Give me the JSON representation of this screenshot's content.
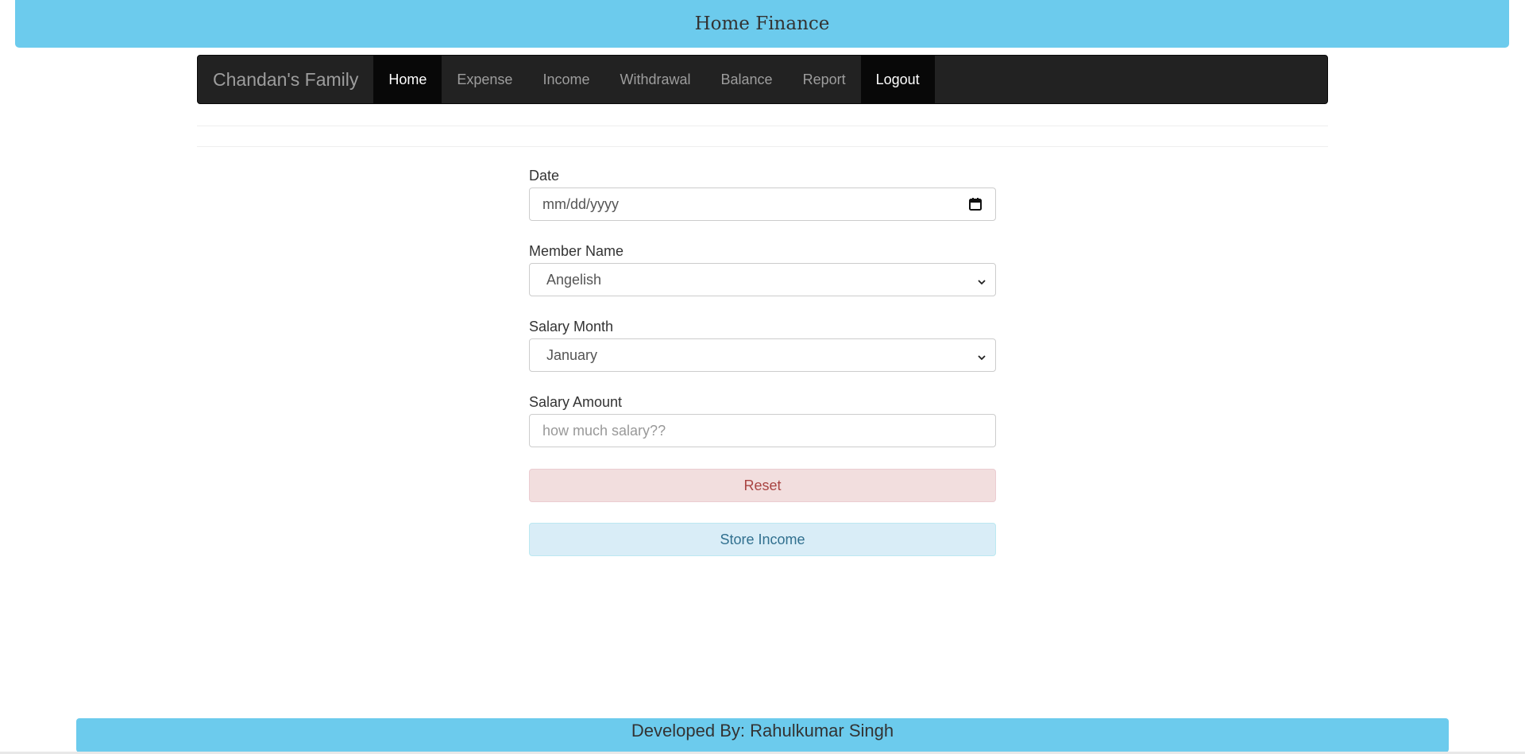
{
  "header": {
    "title": "Home Finance"
  },
  "navbar": {
    "brand": "Chandan's Family",
    "items": [
      {
        "label": "Home",
        "active": true
      },
      {
        "label": "Expense",
        "active": false
      },
      {
        "label": "Income",
        "active": false
      },
      {
        "label": "Withdrawal",
        "active": false
      },
      {
        "label": "Balance",
        "active": false
      },
      {
        "label": "Report",
        "active": false
      },
      {
        "label": "Logout",
        "active": true
      }
    ]
  },
  "form": {
    "date": {
      "label": "Date",
      "placeholder": "mm/dd/yyyy",
      "icon": "calendar-icon"
    },
    "member": {
      "label": "Member Name",
      "selected": "Angelish",
      "icon": "chevron-down-icon"
    },
    "salary_month": {
      "label": "Salary Month",
      "selected": "January",
      "icon": "chevron-down-icon"
    },
    "salary_amount": {
      "label": "Salary Amount",
      "placeholder": "how much salary??"
    },
    "reset_label": "Reset",
    "store_label": "Store Income"
  },
  "footer": {
    "text": "Developed By: Rahulkumar Singh"
  },
  "colors": {
    "banner": "#6ccbed",
    "navbar": "#222222",
    "reset_bg": "#f2dede",
    "reset_text": "#a94442",
    "store_bg": "#d9edf7",
    "store_text": "#31708f"
  }
}
